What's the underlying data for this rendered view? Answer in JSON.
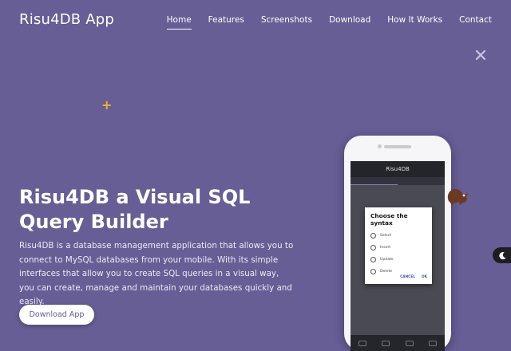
{
  "header": {
    "brand": "Risu4DB App",
    "nav": [
      {
        "label": "Home",
        "active": true
      },
      {
        "label": "Features"
      },
      {
        "label": "Screenshots"
      },
      {
        "label": "Download"
      },
      {
        "label": "How It Works"
      },
      {
        "label": "Contact"
      }
    ]
  },
  "hero": {
    "title": "Risu4DB a Visual SQL Query Builder",
    "description": "Risu4DB is a database management application that allows you to connect to MySQL databases from your mobile. With its simple interfaces that allow you to create SQL queries in a visual way, you can create, manage and maintain your databases quickly and easily.",
    "cta_label": "Download App"
  },
  "phone": {
    "app_title": "Risu4DB",
    "dialog": {
      "title": "Choose the syntax",
      "options": [
        "Select",
        "Insert",
        "Update",
        "Delete"
      ],
      "cancel_label": "CANCEL",
      "ok_label": "OK"
    }
  },
  "icons": {
    "close": "close-icon",
    "plus": "plus-decoration-icon",
    "theme_toggle": "moon-icon",
    "mascot": "squirrel-mascot-icon"
  },
  "colors": {
    "background": "#665e95",
    "accent_plus": "#f5b323",
    "cta_text": "#665e95",
    "toggle_bg": "#1d1d22"
  }
}
